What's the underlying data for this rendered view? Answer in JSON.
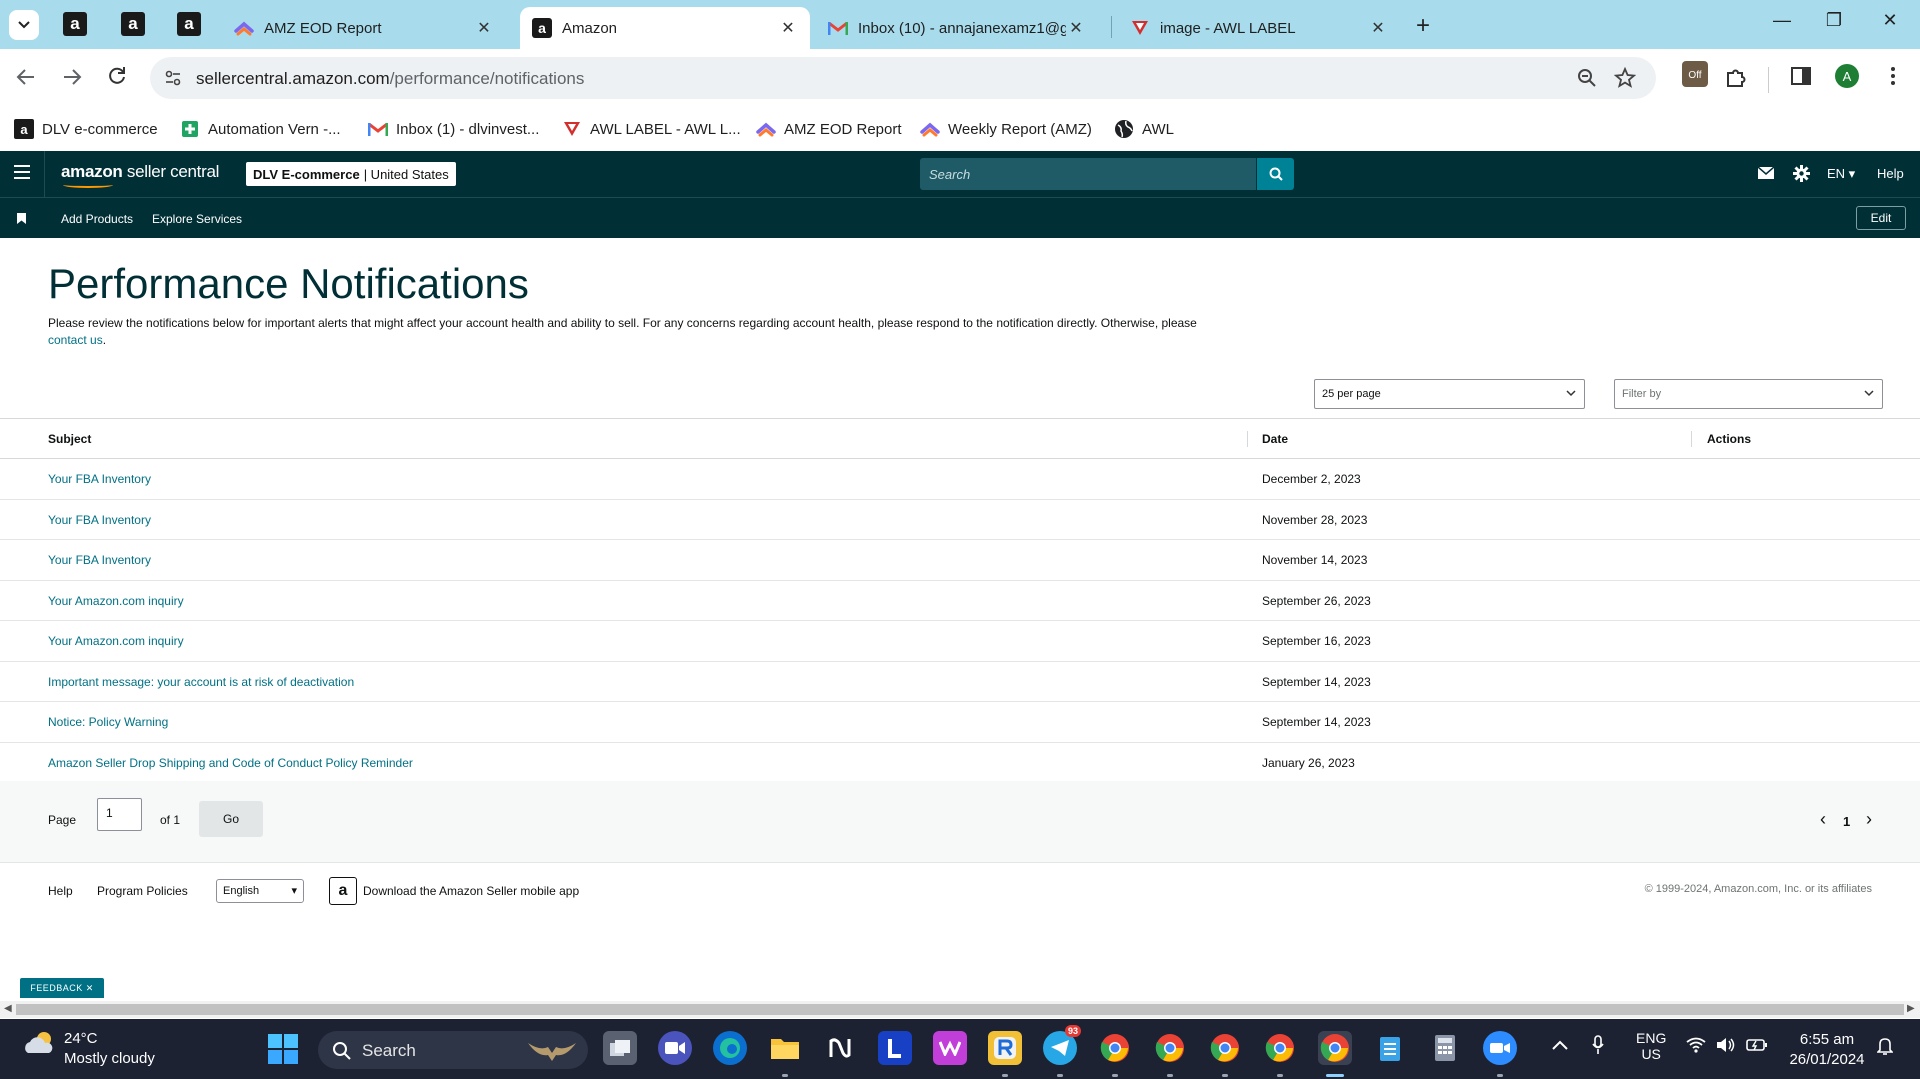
{
  "browser": {
    "tabs": [
      {
        "title": "AMZ EOD Report",
        "close": "✕"
      },
      {
        "title": "Amazon",
        "close": "✕"
      },
      {
        "title": "Inbox (10) - annajanexamz1@g",
        "close": "✕"
      },
      {
        "title": "image - AWL LABEL",
        "close": "✕"
      }
    ],
    "pinned_tab_letter": "a",
    "new_tab": "+",
    "window_controls": {
      "minimize": "—",
      "restore": "❐",
      "close": "✕"
    },
    "url_host": "sellercentral.amazon.com",
    "url_path": "/performance/notifications",
    "profile_letter": "A",
    "extension_badge": "Off",
    "bookmarks": [
      {
        "label": "DLV e-commerce",
        "icon": "amazon-icon"
      },
      {
        "label": "Automation Vern -...",
        "icon": "sheets-icon"
      },
      {
        "label": "Inbox (1) - dlvinvest...",
        "icon": "gmail-icon"
      },
      {
        "label": "AWL LABEL - AWL L...",
        "icon": "awl-icon"
      },
      {
        "label": "AMZ EOD Report",
        "icon": "clickup-icon"
      },
      {
        "label": "Weekly Report (AMZ)",
        "icon": "clickup-icon"
      },
      {
        "label": "AWL",
        "icon": "globe-icon"
      }
    ]
  },
  "header": {
    "logo_bold": "amazon",
    "logo_rest": " seller central",
    "account_name": "DLV E-commerce",
    "account_region": "| United States",
    "search_placeholder": "Search",
    "language": "EN ▾",
    "help": "Help"
  },
  "subnav": {
    "links": [
      "Add Products",
      "Explore Services"
    ],
    "edit": "Edit"
  },
  "page": {
    "title": "Performance Notifications",
    "description": "Please review the notifications below for important alerts that might affect your account health and ability to sell. For any concerns regarding account health, please respond to the notification directly. Otherwise, please",
    "contact_link": "contact us",
    "per_page": "25 per page",
    "filter_placeholder": "Filter by"
  },
  "table": {
    "headers": {
      "subject": "Subject",
      "date": "Date",
      "actions": "Actions"
    },
    "rows": [
      {
        "subject": "Your FBA Inventory",
        "date": "December 2, 2023"
      },
      {
        "subject": "Your FBA Inventory",
        "date": "November 28, 2023"
      },
      {
        "subject": "Your FBA Inventory",
        "date": "November 14, 2023"
      },
      {
        "subject": "Your Amazon.com inquiry",
        "date": "September 26, 2023"
      },
      {
        "subject": "Your Amazon.com inquiry",
        "date": "September 16, 2023"
      },
      {
        "subject": "Important message: your account is at risk of deactivation",
        "date": "September 14, 2023"
      },
      {
        "subject": "Notice: Policy Warning",
        "date": "September 14, 2023"
      },
      {
        "subject": "Amazon Seller Drop Shipping and Code of Conduct Policy Reminder",
        "date": "January 26, 2023"
      }
    ]
  },
  "pager": {
    "page_label": "Page",
    "page_value": "1",
    "of_label": "of 1",
    "go": "Go",
    "current": "1",
    "prev": "‹",
    "next": "›"
  },
  "footer": {
    "help": "Help",
    "program_policies": "Program Policies",
    "language": "English",
    "app_download": "Download the Amazon Seller mobile app",
    "copyright": "© 1999-2024, Amazon.com, Inc. or its affiliates"
  },
  "feedback": "FEEDBACK ✕",
  "taskbar": {
    "temperature": "24°C",
    "weather": "Mostly cloudy",
    "search": "Search",
    "telegram_badge": "93",
    "language_top": "ENG",
    "language_bottom": "US",
    "time": "6:55 am",
    "date": "26/01/2024"
  },
  "colors": {
    "header_bg": "#002f36",
    "link": "#007185",
    "tabstrip_bg": "#a8dced",
    "taskbar_bg": "#1c2232"
  }
}
